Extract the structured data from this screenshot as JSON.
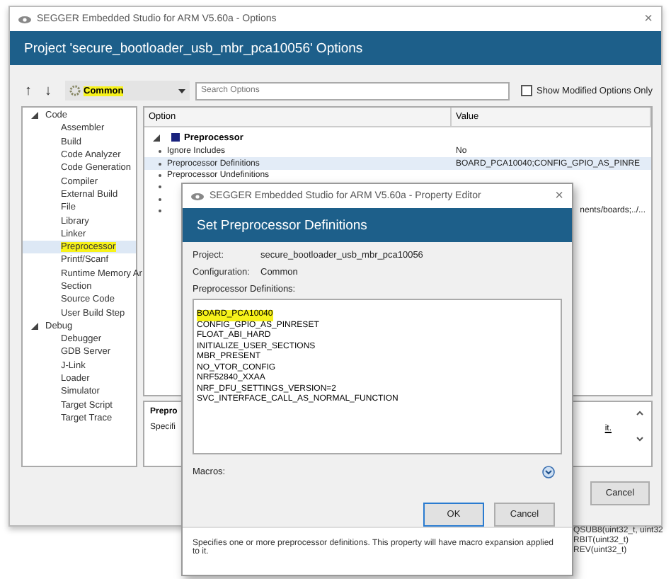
{
  "window": {
    "title": "SEGGER Embedded Studio for ARM V5.60a - Options",
    "close": "×",
    "header": "Project 'secure_bootloader_usb_mbr_pca10056' Options"
  },
  "toolbar": {
    "up": "↑",
    "down": "↓",
    "configuration": {
      "value": "Common",
      "highlighted": true
    },
    "search": {
      "placeholder": "Search Options"
    },
    "show_modified": {
      "label": "Show Modified Options Only",
      "checked": false
    }
  },
  "tree": [
    {
      "label": "Code",
      "expanded": true,
      "children": [
        {
          "label": "Assembler",
          "selected": false,
          "highlighted": false
        },
        {
          "label": "Build",
          "selected": false,
          "highlighted": false
        },
        {
          "label": "Code Analyzer",
          "selected": false,
          "highlighted": false
        },
        {
          "label": "Code Generation",
          "selected": false,
          "highlighted": false
        },
        {
          "label": "Compiler",
          "selected": false,
          "highlighted": false
        },
        {
          "label": "External Build",
          "selected": false,
          "highlighted": false
        },
        {
          "label": "File",
          "selected": false,
          "highlighted": false
        },
        {
          "label": "Library",
          "selected": false,
          "highlighted": false
        },
        {
          "label": "Linker",
          "selected": false,
          "highlighted": false
        },
        {
          "label": "Preprocessor",
          "selected": true,
          "highlighted": true
        },
        {
          "label": "Printf/Scanf",
          "selected": false,
          "highlighted": false
        },
        {
          "label": "Runtime Memory Ar",
          "selected": false,
          "highlighted": false
        },
        {
          "label": "Section",
          "selected": false,
          "highlighted": false
        },
        {
          "label": "Source Code",
          "selected": false,
          "highlighted": false
        },
        {
          "label": "User Build Step",
          "selected": false,
          "highlighted": false
        }
      ]
    },
    {
      "label": "Debug",
      "expanded": true,
      "children": [
        {
          "label": "Debugger",
          "selected": false,
          "highlighted": false
        },
        {
          "label": "GDB Server",
          "selected": false,
          "highlighted": false
        },
        {
          "label": "J-Link",
          "selected": false,
          "highlighted": false
        },
        {
          "label": "Loader",
          "selected": false,
          "highlighted": false
        },
        {
          "label": "Simulator",
          "selected": false,
          "highlighted": false
        },
        {
          "label": "Target Script",
          "selected": false,
          "highlighted": false
        },
        {
          "label": "Target Trace",
          "selected": false,
          "highlighted": false
        }
      ]
    }
  ],
  "grid": {
    "columns": [
      "Option",
      "Value"
    ],
    "group": {
      "label": "Preprocessor",
      "expanded": true
    },
    "rows": [
      {
        "name": "Ignore Includes",
        "value": "No",
        "selected": false
      },
      {
        "name": "Preprocessor Definitions",
        "value": "BOARD_PCA10040;CONFIG_GPIO_AS_PINRE",
        "selected": true
      },
      {
        "name": "Preprocessor Undefinitions",
        "selected": false
      },
      {
        "selected": false
      },
      {
        "selected": false
      },
      {
        "value": "nents/boards;../...",
        "selected": false
      }
    ]
  },
  "description": {
    "title": "Prepro",
    "text": "Specifi",
    "tail": "it."
  },
  "buttons": [
    {
      "label": "Cancel",
      "default": false
    }
  ],
  "background_code": [
    "QSUB8(uint32_t, uint32",
    "RBIT(uint32_t)",
    "REV(uint32_t)"
  ],
  "dialog": {
    "title": "SEGGER Embedded Studio for ARM V5.60a - Property Editor",
    "close": "×",
    "header": "Set Preprocessor Definitions",
    "fields": [
      {
        "label": "Project:",
        "value": "secure_bootloader_usb_mbr_pca10056"
      },
      {
        "label": "Configuration:",
        "value": "Common"
      }
    ],
    "definitions_label": "Preprocessor Definitions:",
    "definitions": [
      {
        "text": "BOARD_PCA10040",
        "highlighted": true
      },
      {
        "text": "CONFIG_GPIO_AS_PINRESET",
        "highlighted": false
      },
      {
        "text": "FLOAT_ABI_HARD",
        "highlighted": false
      },
      {
        "text": "INITIALIZE_USER_SECTIONS",
        "highlighted": false
      },
      {
        "text": "MBR_PRESENT",
        "highlighted": false
      },
      {
        "text": "NO_VTOR_CONFIG",
        "highlighted": false
      },
      {
        "text": "NRF52840_XXAA",
        "highlighted": false
      },
      {
        "text": "NRF_DFU_SETTINGS_VERSION=2",
        "highlighted": false
      },
      {
        "text": "SVC_INTERFACE_CALL_AS_NORMAL_FUNCTION",
        "highlighted": false
      }
    ],
    "macros": {
      "label": "Macros:",
      "expanded": false
    },
    "buttons": [
      {
        "label": "OK",
        "default": true
      },
      {
        "label": "Cancel",
        "default": false
      }
    ],
    "description": "Specifies one or more preprocessor definitions. This property will have macro expansion applied to it."
  }
}
